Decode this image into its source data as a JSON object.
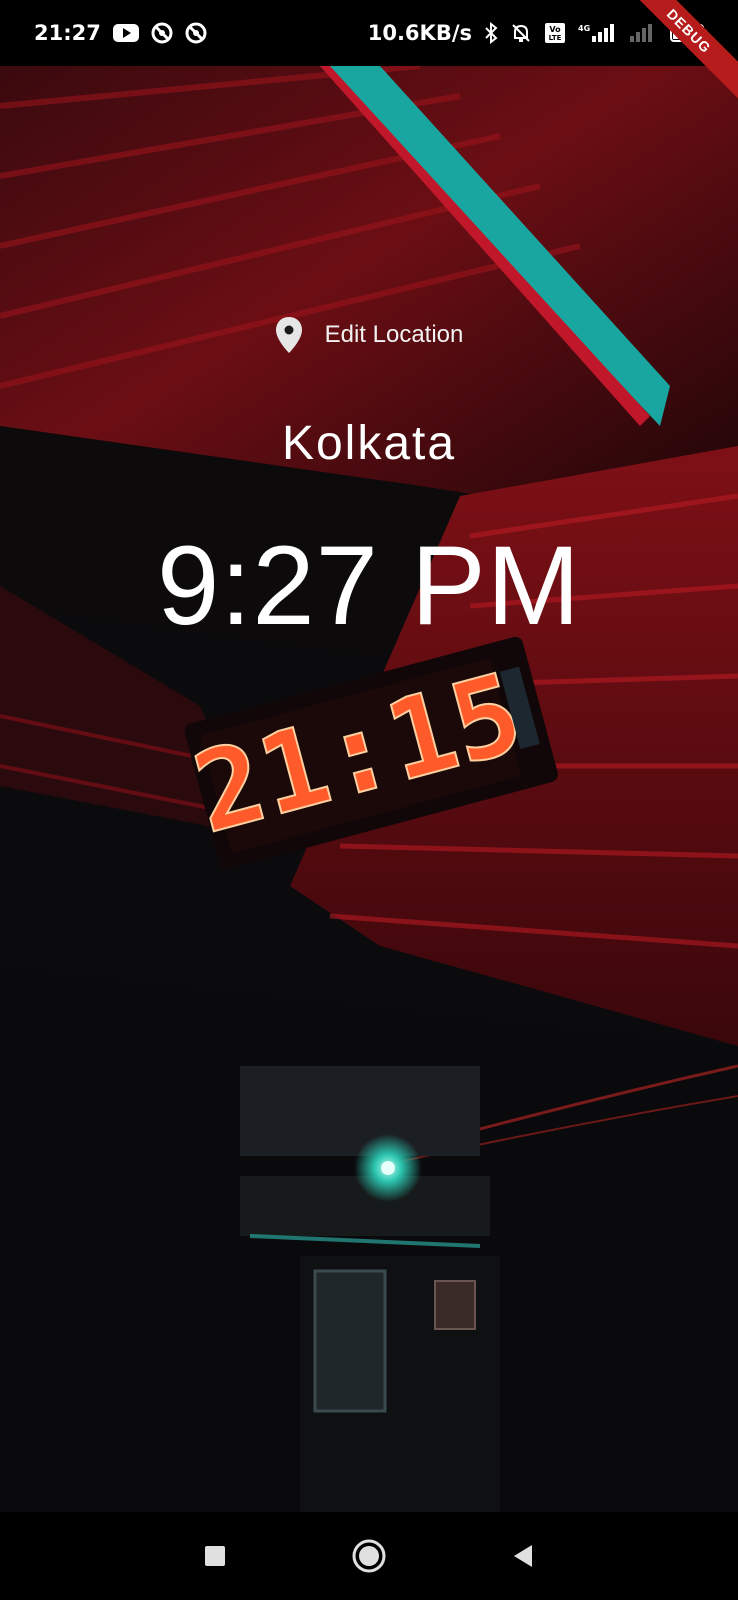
{
  "status_bar": {
    "time": "21:27",
    "net_speed": "10.6KB/s",
    "battery": "13",
    "icons": [
      "youtube-icon",
      "sync-icon",
      "sync-icon",
      "bluetooth-icon",
      "mute-bell-icon",
      "volte-icon",
      "signal-4g-icon",
      "signal-empty-icon",
      "battery-icon"
    ]
  },
  "debug_banner": "DEBUG",
  "main": {
    "edit_location_label": "Edit Location",
    "location_icon": "location-pin-icon",
    "city": "Kolkata",
    "time": "9:27 PM"
  },
  "background": {
    "clock_display": "21:15"
  },
  "nav": {
    "items": [
      "recents-square-icon",
      "home-circle-icon",
      "back-triangle-icon"
    ]
  },
  "colors": {
    "accent_red": "#e53935",
    "teal": "#18b3a8"
  }
}
